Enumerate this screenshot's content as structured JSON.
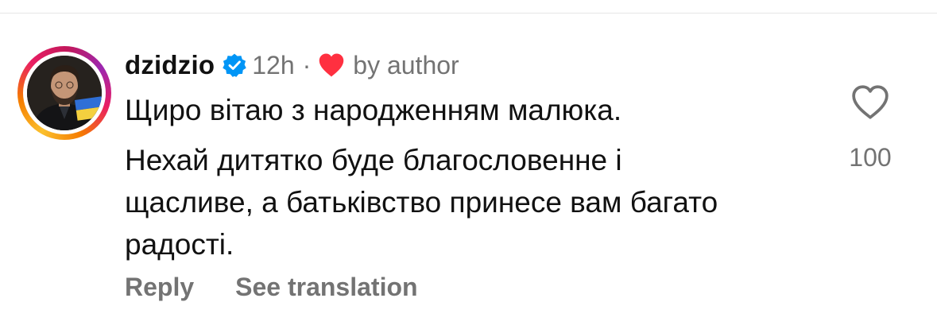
{
  "comment": {
    "username": "dzidzio",
    "verified": true,
    "time": "12h",
    "separator": "·",
    "liked_by": "by author",
    "paragraphs": [
      "Щиро вітаю з народженням малюка.",
      "Нехай дитятко буде благословенне і щасливе, а батьківство принесе вам багато радості."
    ],
    "like_count": "100",
    "actions": {
      "reply": "Reply",
      "see_translation": "See translation"
    }
  },
  "icons": {
    "verified": "verified-badge-icon",
    "author_like": "heart-filled-icon",
    "like": "heart-outline-icon"
  },
  "colors": {
    "verified_blue": "#0095f6",
    "heart_red": "#ff3040",
    "secondary_text": "#737373",
    "primary_text": "#111111"
  }
}
